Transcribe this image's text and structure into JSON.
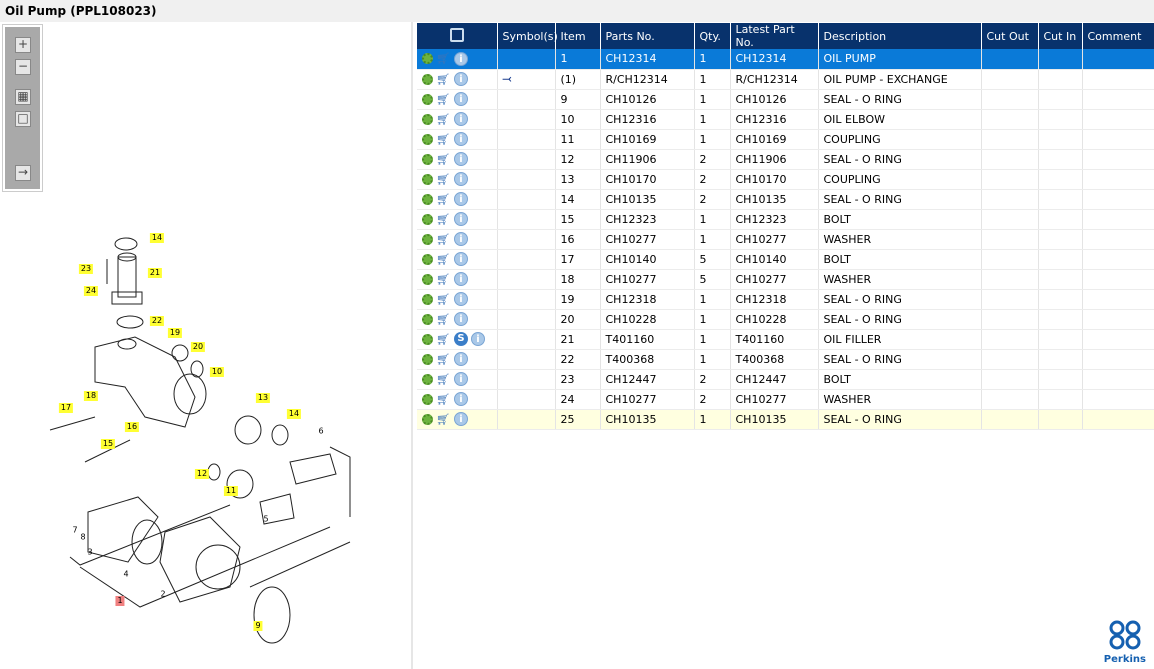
{
  "title": "Oil Pump (PPL108023)",
  "toolbar": [
    "zoom-in",
    "zoom-out",
    "fit-all",
    "actual-size",
    "toggle-panel"
  ],
  "diagram": {
    "callouts": [
      "14",
      "23",
      "21",
      "24",
      "22",
      "19",
      "20",
      "10",
      "13",
      "18",
      "17",
      "14",
      "16",
      "15",
      "12",
      "11",
      "9"
    ],
    "highlighted": "1",
    "plain": [
      "6",
      "5",
      "7",
      "8",
      "3",
      "4",
      "2"
    ]
  },
  "table": {
    "headers": [
      "Symbol(s)",
      "Item",
      "Parts No.",
      "Qty.",
      "Latest Part No.",
      "Description",
      "Cut Out",
      "Cut In",
      "Comment"
    ],
    "rows": [
      [
        "",
        "1",
        "CH12314",
        "1",
        "CH12314",
        "OIL PUMP"
      ],
      [
        "exchange",
        "(1)",
        "R/CH12314",
        "1",
        "R/CH12314",
        "OIL PUMP - EXCHANGE"
      ],
      [
        "",
        "9",
        "CH10126",
        "1",
        "CH10126",
        "SEAL - O RING"
      ],
      [
        "",
        "10",
        "CH12316",
        "1",
        "CH12316",
        "OIL ELBOW"
      ],
      [
        "",
        "11",
        "CH10169",
        "1",
        "CH10169",
        "COUPLING"
      ],
      [
        "",
        "12",
        "CH11906",
        "2",
        "CH11906",
        "SEAL - O RING"
      ],
      [
        "",
        "13",
        "CH10170",
        "2",
        "CH10170",
        "COUPLING"
      ],
      [
        "",
        "14",
        "CH10135",
        "2",
        "CH10135",
        "SEAL - O RING"
      ],
      [
        "",
        "15",
        "CH12323",
        "1",
        "CH12323",
        "BOLT"
      ],
      [
        "",
        "16",
        "CH10277",
        "1",
        "CH10277",
        "WASHER"
      ],
      [
        "",
        "17",
        "CH10140",
        "5",
        "CH10140",
        "BOLT"
      ],
      [
        "",
        "18",
        "CH10277",
        "5",
        "CH10277",
        "WASHER"
      ],
      [
        "",
        "19",
        "CH12318",
        "1",
        "CH12318",
        "SEAL - O RING"
      ],
      [
        "",
        "20",
        "CH10228",
        "1",
        "CH10228",
        "SEAL - O RING"
      ],
      [
        "",
        "21",
        "T401160",
        "1",
        "T401160",
        "OIL FILLER"
      ],
      [
        "",
        "22",
        "T400368",
        "1",
        "T400368",
        "SEAL - O RING"
      ],
      [
        "",
        "23",
        "CH12447",
        "2",
        "CH12447",
        "BOLT"
      ],
      [
        "",
        "24",
        "CH10277",
        "2",
        "CH10277",
        "WASHER"
      ],
      [
        "",
        "25",
        "CH10135",
        "1",
        "CH10135",
        "SEAL - O RING"
      ]
    ],
    "s_badge": "S",
    "info_glyph": "i"
  },
  "logo": "Perkins",
  "colors": {
    "header": "#08326c",
    "selected": "#0a7ad8",
    "callout": "#ffff33"
  }
}
